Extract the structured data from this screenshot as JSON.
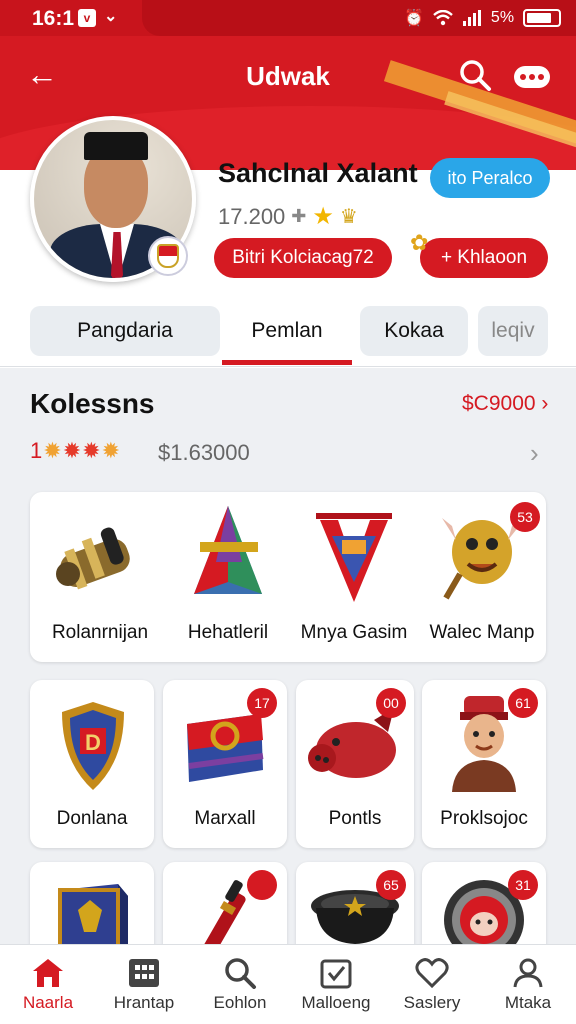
{
  "status_bar": {
    "time": "16:1",
    "battery": "5%"
  },
  "header": {
    "title": "Udwak"
  },
  "profile": {
    "name": "Sahclnal Xalant",
    "follow_label": "ito Peralco",
    "stats": "17.200",
    "left_pill": "Bitri Kolciacag72",
    "right_pill": "+ Khlaoon"
  },
  "tabs": [
    "Pangdaria",
    "Pemlan",
    "Kokaa",
    "leqiv"
  ],
  "section": {
    "title": "Kolessns",
    "link": "$C9000 ›",
    "rating_prefix": "1",
    "total": "$1.63000"
  },
  "collection": [
    {
      "label": "Rolanrnijan",
      "icon": "cannon-icon"
    },
    {
      "label": "Hehatleril",
      "icon": "tent-flag-icon"
    },
    {
      "label": "Mnya Gasim",
      "icon": "banner-icon"
    },
    {
      "label": "Walec Manp",
      "icon": "mask-icon",
      "badge": "53"
    }
  ],
  "grid": [
    {
      "label": "Donlana",
      "icon": "shield-icon"
    },
    {
      "label": "Marxall",
      "icon": "chest-icon",
      "badge": "17"
    },
    {
      "label": "Pontls",
      "icon": "boar-icon",
      "badge": "00"
    },
    {
      "label": "Proklsojoc",
      "icon": "soldier-icon",
      "badge": "61"
    }
  ],
  "grid2": [
    {
      "icon": "box-icon"
    },
    {
      "icon": "torch-icon"
    },
    {
      "icon": "pot-icon",
      "badge": "65"
    },
    {
      "icon": "gear-face-icon",
      "badge": "31"
    }
  ],
  "bottom_nav": [
    "Naarla",
    "Hrantap",
    "Eohlon",
    "Malloeng",
    "Saslery",
    "Mtaka"
  ],
  "colors": {
    "primary": "#d51a22",
    "accent": "#2aa6e8"
  }
}
